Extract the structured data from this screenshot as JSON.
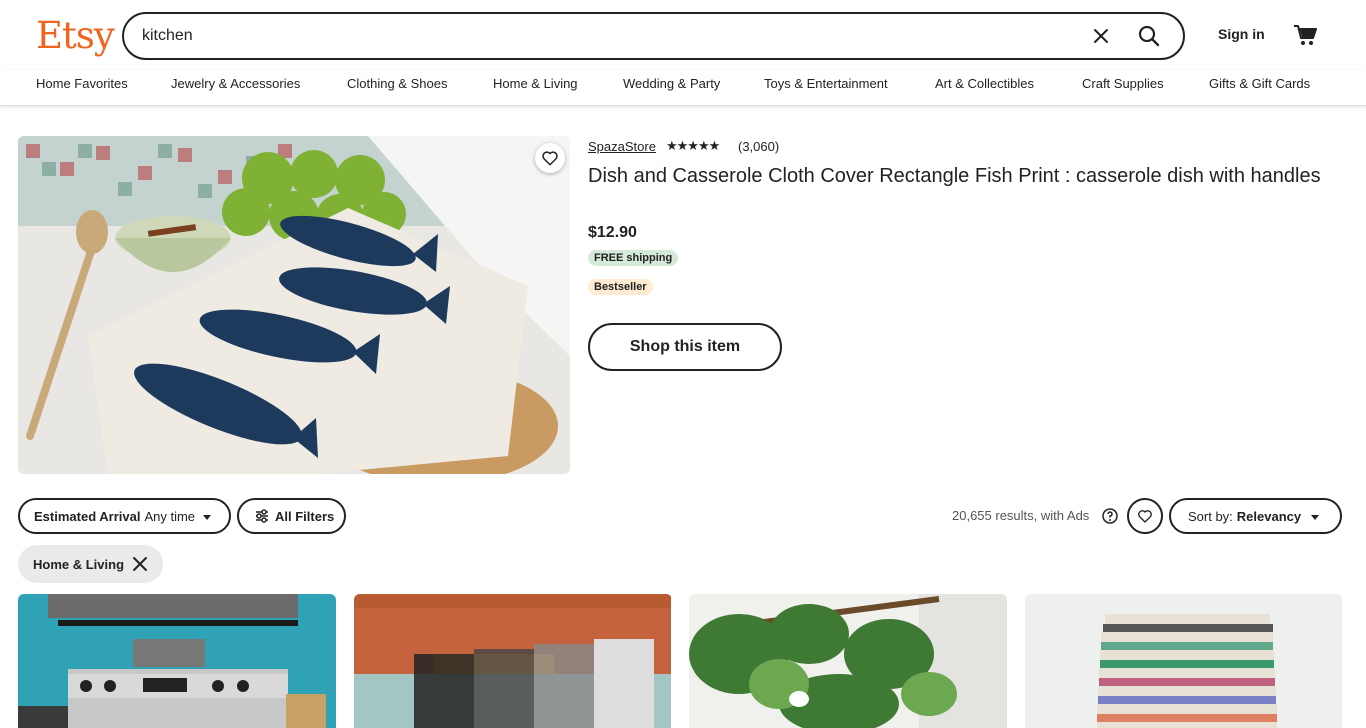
{
  "header": {
    "logo": "Etsy",
    "search_value": "kitchen",
    "signin_label": "Sign in",
    "colors": {
      "brand": "#f1641e"
    }
  },
  "nav": [
    "Home Favorites",
    "Jewelry & Accessories",
    "Clothing & Shoes",
    "Home & Living",
    "Wedding & Party",
    "Toys & Entertainment",
    "Art & Collectibles",
    "Craft Supplies",
    "Gifts & Gift Cards"
  ],
  "ad": {
    "shop_name": "SpazaStore",
    "rating_stars": "★★★★★",
    "review_count": "(3,060)",
    "title": "Dish and Casserole Cloth Cover Rectangle Fish Print : casserole dish with handles",
    "price": "$12.90",
    "shipping_badge": "FREE shipping",
    "bestseller_badge": "Bestseller",
    "cta_label": "Shop this item"
  },
  "filters": {
    "arrival_label": "Estimated Arrival",
    "arrival_value": "Any time",
    "all_filters_label": "All Filters",
    "results_text": "20,655 results, with Ads",
    "sort_label": "Sort by:",
    "sort_value": "Relevancy",
    "active_chip": "Home & Living"
  }
}
